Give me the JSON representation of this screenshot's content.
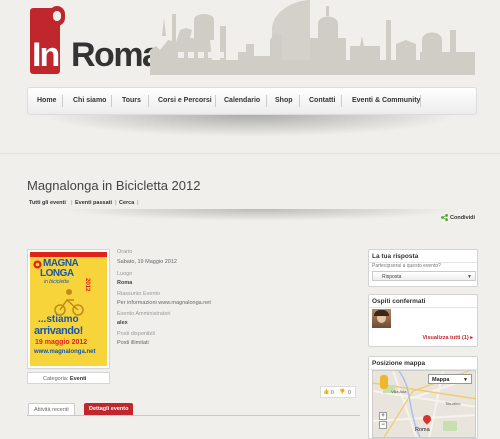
{
  "brand": {
    "prefix": "In",
    "name": "Roma"
  },
  "nav": {
    "items": [
      "Home",
      "Chi siamo",
      "Tours",
      "Corsi e Percorsi",
      "Calendario",
      "Shop",
      "Contatti",
      "Eventi & Community"
    ]
  },
  "page": {
    "title": "Magnalonga in Bicicletta 2012"
  },
  "subnav": {
    "all_events": "Tutti gli eventi",
    "past_events": "Eventi passati",
    "search": "Cerca"
  },
  "share": {
    "label": "Condividi"
  },
  "poster": {
    "line1": "MAGNA",
    "line2": "LONGA",
    "line3": "in bicicletta",
    "year": "2012",
    "tag1": "...stiamo",
    "tag2": "arrivando!",
    "date": "19 maggio 2012",
    "url": "www.magnalonga.net"
  },
  "category": {
    "label": "Categoria:",
    "value": "Eventi"
  },
  "details": {
    "time_label": "Orario",
    "time_value": "Sabato, 19 Maggio 2012",
    "place_label": "Luogo",
    "place_value": "Roma",
    "summary_label": "Riassunto Evento",
    "summary_value": "Per informazioni www.magnalonga.net",
    "admin_label": "Evento Amministratori",
    "admin_value": "alex",
    "seats_label": "Posti disponibili",
    "seats_value": "Posti illimitati"
  },
  "votes": {
    "up": "0",
    "down": "0"
  },
  "tabs": {
    "recent": "Attività recenti",
    "details": "Dettagli evento"
  },
  "sidebar": {
    "rsvp": {
      "title": "La tua risposta",
      "question": "Partecipserai a questo evento?",
      "select": "Risposta"
    },
    "guests": {
      "title": "Ospiti confermati",
      "view_all": "Visualizza tutti (1)"
    },
    "map": {
      "title": "Posizione mappa",
      "type": "Mappa",
      "city": "Roma",
      "place1": "Villa Ada",
      "place2": "Tiburtino"
    }
  },
  "colors": {
    "accent": "#c0272d",
    "background": "#f0efeb"
  }
}
